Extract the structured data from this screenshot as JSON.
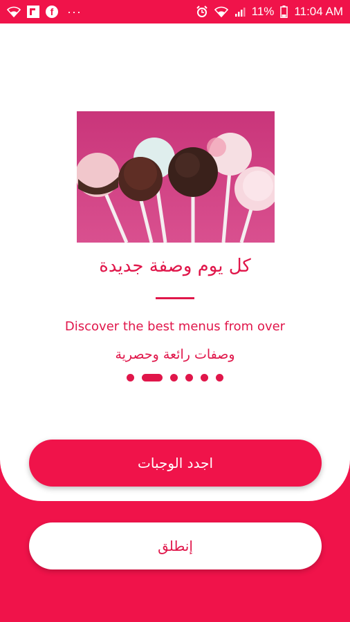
{
  "status_bar": {
    "left_icons": [
      "wifi-icon",
      "flipboard-icon",
      "facebook-icon",
      "more-icon"
    ],
    "battery_text": "11%",
    "time": "11:04 AM",
    "right_icons": [
      "alarm-icon",
      "wifi-icon",
      "signal-icon",
      "battery-icon"
    ]
  },
  "onboarding": {
    "title": "كل يوم وصفة جديدة",
    "description_en": "Discover the best menus from over",
    "description_ar": "وصفات رائعة وحصرية",
    "pager": {
      "count": 6,
      "active_index": 1
    }
  },
  "buttons": {
    "find_meals_label": "اجدد الوجبات",
    "start_label": "إنطلق"
  },
  "colors": {
    "accent": "#f0134a",
    "text_accent": "#e0164a",
    "hero_background": "#d13d83"
  }
}
